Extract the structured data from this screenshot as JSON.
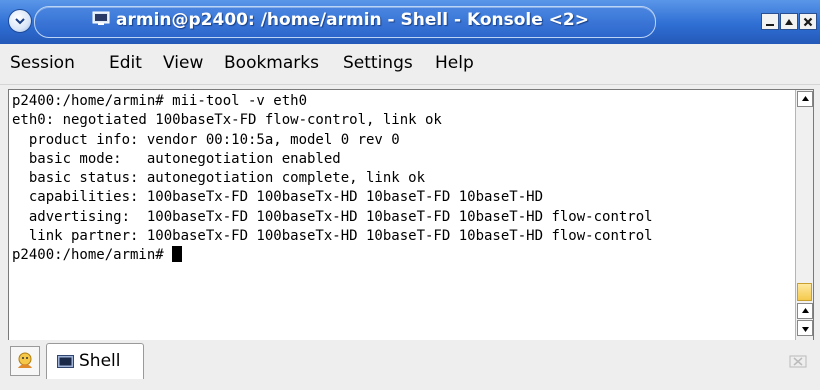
{
  "window": {
    "title": "armin@p2400: /home/armin - Shell - Konsole <2>"
  },
  "menu": {
    "items": [
      {
        "label": "Session"
      },
      {
        "label": "Edit"
      },
      {
        "label": "View"
      },
      {
        "label": "Bookmarks"
      },
      {
        "label": "Settings"
      },
      {
        "label": "Help"
      }
    ]
  },
  "terminal": {
    "lines": [
      "p2400:/home/armin# mii-tool -v eth0",
      "eth0: negotiated 100baseTx-FD flow-control, link ok",
      "  product info: vendor 00:10:5a, model 0 rev 0",
      "  basic mode:   autonegotiation enabled",
      "  basic status: autonegotiation complete, link ok",
      "  capabilities: 100baseTx-FD 100baseTx-HD 10baseT-FD 10baseT-HD",
      "  advertising:  100baseTx-FD 100baseTx-HD 10baseT-FD 10baseT-HD flow-control",
      "  link partner: 100baseTx-FD 100baseTx-HD 10baseT-FD 10baseT-HD flow-control"
    ],
    "prompt": "p2400:/home/armin# "
  },
  "tabs": [
    {
      "label": "Shell",
      "active": true
    }
  ],
  "colors": {
    "titlebar": "#2f6fd4",
    "scroll_thumb": "#f4c94c"
  },
  "icons": {
    "system_menu": "chevron-down-icon",
    "title": "terminal-icon",
    "new_session": "new-session-icon",
    "close_session": "close-session-icon"
  }
}
